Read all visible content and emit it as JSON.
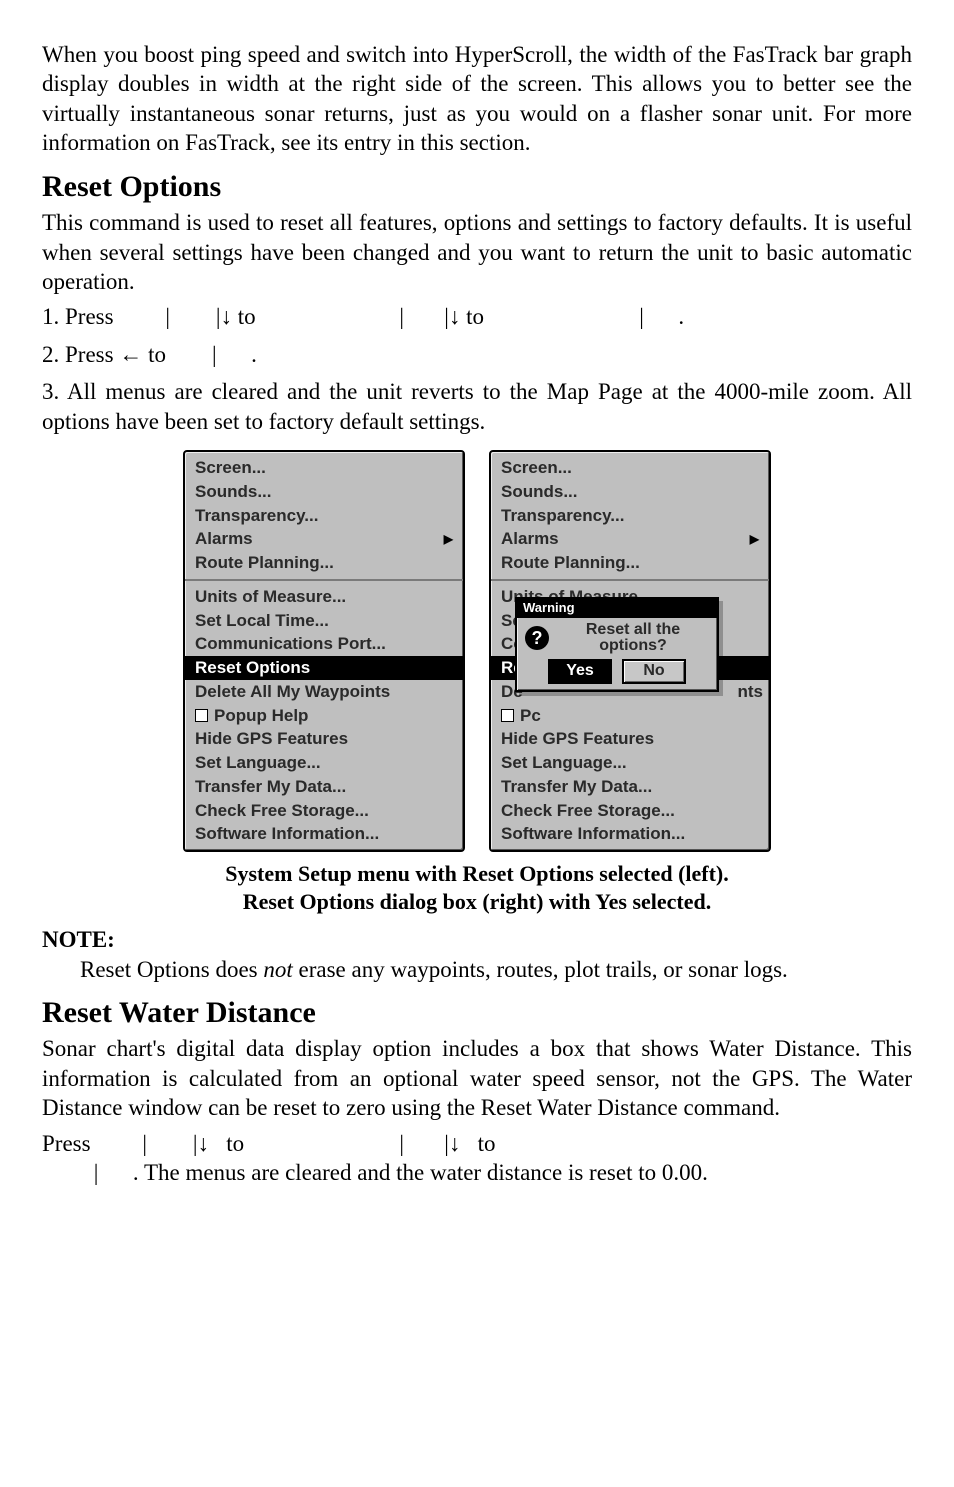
{
  "intro_para": "When you boost ping speed and switch into HyperScroll, the width of the FasTrack bar graph display doubles in width at the right side of the screen. This allows you to better see the virtually instantaneous sonar returns, just as you would on a flasher sonar unit. For more information on FasTrack, see its entry in this section.",
  "reset_options": {
    "heading": "Reset Options",
    "para": "This command is used to reset all features, options and settings to factory defaults. It is useful when several settings have been changed and you want to return the unit to basic automatic operation.",
    "step1_a": "1. Press ",
    "step1_b": " to ",
    "step1_c": " to ",
    "step1_end": ".",
    "step2_a": "2. Press ",
    "step2_b": " to ",
    "step2_end": ".",
    "step3": "3. All menus are cleared and the unit reverts to the Map Page at the 4000-mile zoom. All options have been set to factory default settings.",
    "caption_l1": "System Setup menu with Reset Options selected (left).",
    "caption_l2": "Reset Options dialog box (right) with Yes selected.",
    "note_head": "NOTE:",
    "note_body_pre": "Reset Options does ",
    "note_body_em": "not",
    "note_body_post": " erase any waypoints, routes, plot trails, or sonar logs."
  },
  "reset_water": {
    "heading": "Reset Water Distance",
    "para": "Sonar chart's digital data display option includes a box that shows Water Distance. This information is calculated from an optional water speed sensor, not the GPS. The Water Distance window can be reset to zero using the Reset Water Distance command.",
    "press_a": "Press ",
    "press_b": " to ",
    "press_c": " to ",
    "tail": ". The menus are cleared and the water distance is reset to 0.00."
  },
  "menu": {
    "sec1": [
      "Screen...",
      "Sounds...",
      "Transparency...",
      "Alarms",
      "Route Planning..."
    ],
    "sec2": [
      "Units of Measure...",
      "Set Local Time...",
      "Communications Port...",
      "Reset Options",
      "Delete All My Waypoints",
      "Popup Help",
      "Hide GPS Features",
      "Set Language...",
      "Transfer My Data...",
      "Check Free Storage...",
      "Software Information..."
    ]
  },
  "right_menu": {
    "sec1": [
      "Screen...",
      "Sounds...",
      "Transparency...",
      "Alarms",
      "Route Planning..."
    ],
    "cut_units": "Units of Measure...",
    "se": "Se",
    "co": "Co",
    "re": "Re",
    "de": "De",
    "pc": "Pc",
    "nts": "nts",
    "tail_items": [
      "Hide GPS Features",
      "Set Language...",
      "Transfer My Data...",
      "Check Free Storage...",
      "Software Information..."
    ]
  },
  "dialog": {
    "title": "Warning",
    "line1": "Reset all the",
    "line2": "options?",
    "yes": "Yes",
    "no": "No",
    "q": "?"
  },
  "glyphs": {
    "bar": "|",
    "down": "↓",
    "left": "←"
  }
}
